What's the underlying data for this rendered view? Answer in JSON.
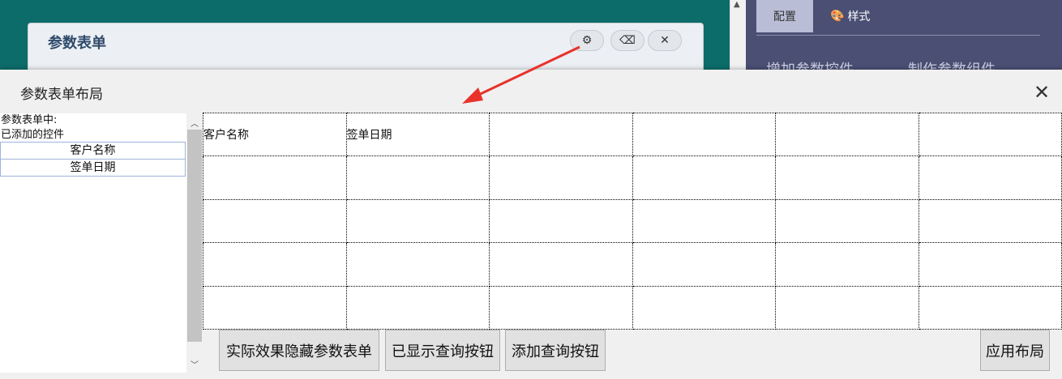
{
  "background": {
    "panel_title": "参数表单",
    "tools": [
      {
        "icon": "gear-icon",
        "glyph": "⚙"
      },
      {
        "icon": "eraser-icon",
        "glyph": "⌫"
      },
      {
        "icon": "close-icon",
        "glyph": "✕"
      }
    ],
    "right_tabs": {
      "config": "配置",
      "style": "样式"
    },
    "right_items": [
      "增加参数控件",
      "制作参数组件"
    ]
  },
  "dialog": {
    "title": "参数表单布局",
    "close_glyph": "✕",
    "left_list": {
      "header_line1": "参数表单中:",
      "header_line2": "已添加的控件",
      "items": [
        "客户名称",
        "签单日期"
      ]
    },
    "grid": {
      "rows": [
        [
          "客户名称",
          "签单日期",
          "",
          "",
          "",
          ""
        ],
        [
          "",
          "",
          "",
          "",
          "",
          ""
        ],
        [
          "",
          "",
          "",
          "",
          "",
          ""
        ],
        [
          "",
          "",
          "",
          "",
          "",
          ""
        ],
        [
          "",
          "",
          "",
          "",
          "",
          ""
        ]
      ]
    },
    "buttons": {
      "hide_form": "实际效果隐藏参数表单",
      "show_query": "已显示查询按钮",
      "add_query": "添加查询按钮",
      "apply_layout": "应用布局"
    }
  },
  "colors": {
    "annotation_arrow": "#e8322b",
    "background_teal": "#0c6c69",
    "right_panel": "#4a4f73"
  }
}
